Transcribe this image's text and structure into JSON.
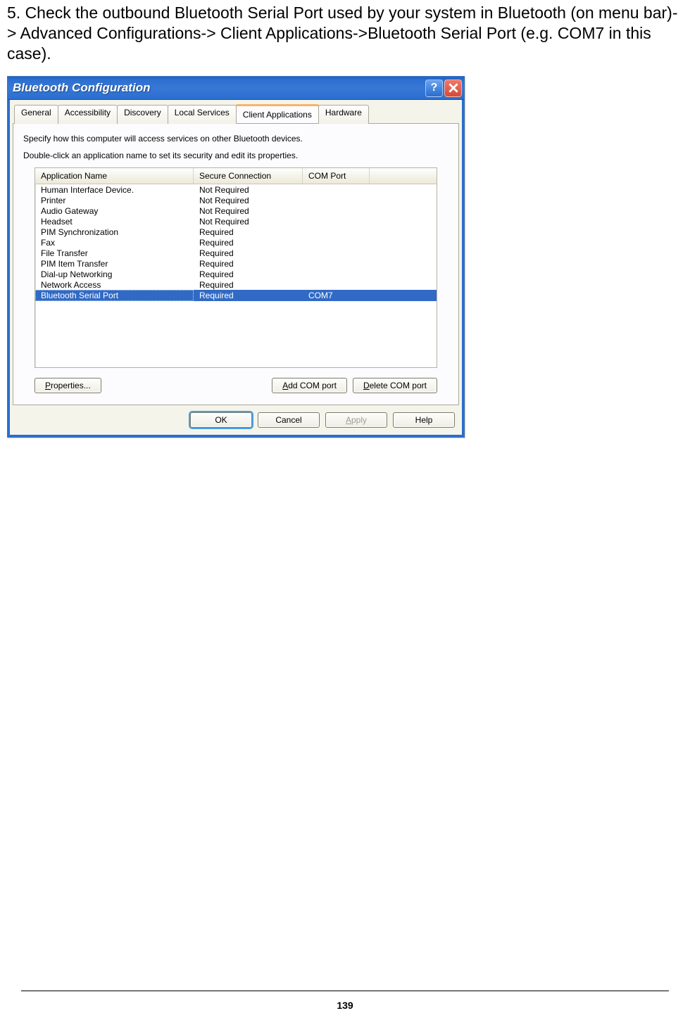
{
  "instruction": "5. Check the outbound Bluetooth Serial Port used by your system in Bluetooth (on menu bar)-> Advanced Configurations-> Client Applications->Bluetooth Serial Port (e.g. COM7 in this case).",
  "dialog": {
    "title": "Bluetooth Configuration",
    "tabs": [
      "General",
      "Accessibility",
      "Discovery",
      "Local Services",
      "Client Applications",
      "Hardware"
    ],
    "active_tab": "Client Applications",
    "desc1": "Specify how this computer will access services on other Bluetooth devices.",
    "desc2": "Double-click an application name to set its security and edit its properties.",
    "columns": {
      "app": "Application Name",
      "sec": "Secure Connection",
      "com": "COM Port"
    },
    "rows": [
      {
        "app": "Human Interface Device.",
        "sec": "Not Required",
        "com": ""
      },
      {
        "app": "Printer",
        "sec": "Not Required",
        "com": ""
      },
      {
        "app": "Audio Gateway",
        "sec": "Not Required",
        "com": ""
      },
      {
        "app": "Headset",
        "sec": "Not Required",
        "com": ""
      },
      {
        "app": "PIM Synchronization",
        "sec": "Required",
        "com": ""
      },
      {
        "app": "Fax",
        "sec": "Required",
        "com": ""
      },
      {
        "app": "File Transfer",
        "sec": "Required",
        "com": ""
      },
      {
        "app": "PIM Item Transfer",
        "sec": "Required",
        "com": ""
      },
      {
        "app": "Dial-up Networking",
        "sec": "Required",
        "com": ""
      },
      {
        "app": "Network Access",
        "sec": "Required",
        "com": ""
      },
      {
        "app": "Bluetooth Serial Port",
        "sec": "Required",
        "com": "COM7",
        "selected": true
      }
    ],
    "buttons": {
      "properties": "Properties...",
      "add": "Add COM port",
      "delete": "Delete COM port",
      "ok": "OK",
      "cancel": "Cancel",
      "apply": "Apply",
      "help": "Help"
    }
  },
  "page_number": "139"
}
